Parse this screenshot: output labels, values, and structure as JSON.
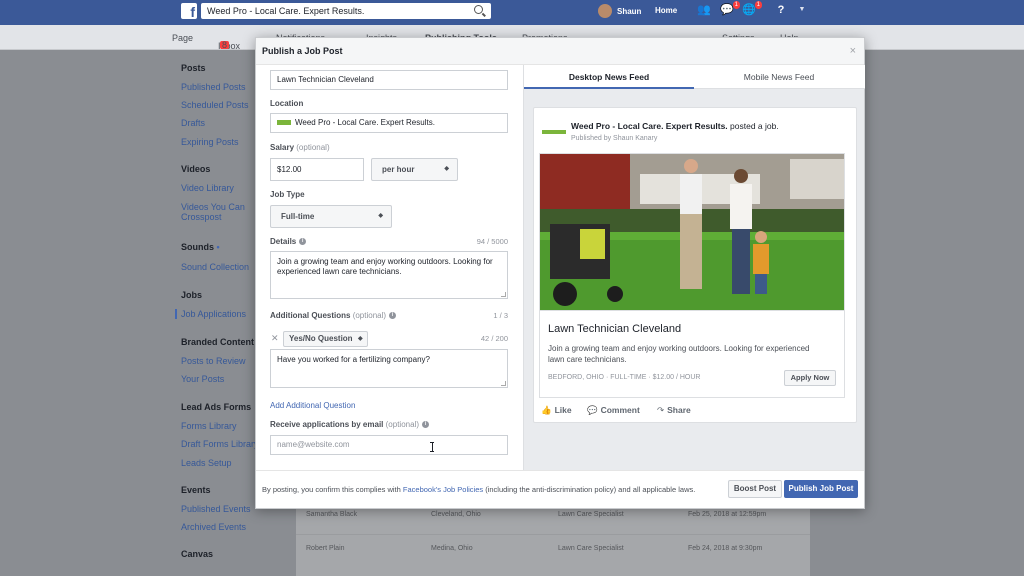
{
  "topbar": {
    "search_value": "Weed Pro - Local Care. Expert Results.",
    "user_name": "Shaun",
    "home_label": "Home",
    "badge_messages": "1",
    "badge_notifications": "1"
  },
  "pagenav": {
    "page": "Page",
    "inbox": "Inbox",
    "inbox_badge": "8",
    "notifications": "Notifications",
    "insights": "Insights",
    "publishing_tools": "Publishing Tools",
    "promotions": "Promotions",
    "settings": "Settings",
    "help": "Help"
  },
  "sidebar": {
    "posts_head": "Posts",
    "published_posts": "Published Posts",
    "scheduled_posts": "Scheduled Posts",
    "drafts": "Drafts",
    "expiring_posts": "Expiring Posts",
    "videos_head": "Videos",
    "video_library": "Video Library",
    "videos_crosspost_1": "Videos You Can",
    "videos_crosspost_2": "Crosspost",
    "sounds_head": "Sounds",
    "sounds_dot": "•",
    "sound_collection": "Sound Collection",
    "jobs_head": "Jobs",
    "job_applications": "Job Applications",
    "branded_head": "Branded Content",
    "posts_to_review": "Posts to Review",
    "your_posts": "Your Posts",
    "leadads_head": "Lead Ads Forms",
    "forms_library": "Forms Library",
    "draft_forms_library": "Draft Forms Library",
    "leads_setup": "Leads Setup",
    "events_head": "Events",
    "published_events": "Published Events",
    "archived_events": "Archived Events",
    "canvas_head": "Canvas"
  },
  "bg_table": {
    "rows": [
      {
        "name": "Samantha Black",
        "location": "Cleveland, Ohio",
        "role": "Lawn Care Specialist",
        "date": "Feb 25, 2018 at 12:59pm"
      },
      {
        "name": "Robert Plain",
        "location": "Medina, Ohio",
        "role": "Lawn Care Specialist",
        "date": "Feb 24, 2018 at 9:30pm"
      }
    ]
  },
  "modal": {
    "title": "Publish a Job Post",
    "close": "×",
    "job_title_value": "Lawn Technician Cleveland",
    "location_label": "Location",
    "location_value": "Weed Pro - Local Care. Expert Results.",
    "salary_label": "Salary",
    "salary_optional": "(optional)",
    "salary_value": "$12.00",
    "salary_period": "per hour",
    "job_type_label": "Job Type",
    "job_type_value": "Full-time",
    "details_label": "Details",
    "details_counter": "94 / 5000",
    "details_value": "Join a growing team and enjoy working outdoors. Looking for experienced lawn care technicians.",
    "additional_label": "Additional Questions",
    "additional_optional": "(optional)",
    "additional_counter": "1 / 3",
    "question_type": "Yes/No Question",
    "question_counter": "42 / 200",
    "question_value": "Have you worked for a fertilizing company?",
    "add_question_link": "Add Additional Question",
    "email_label": "Receive applications by email",
    "email_optional": "(optional)",
    "email_placeholder": "name@website.com",
    "footer_prefix": "By posting, you confirm this complies with ",
    "footer_link": "Facebook's Job Policies",
    "footer_suffix": " (including the anti-discrimination policy) and all applicable laws.",
    "boost_button": "Boost Post",
    "publish_button": "Publish Job Post"
  },
  "preview": {
    "tab_desktop": "Desktop News Feed",
    "tab_mobile": "Mobile News Feed",
    "author": "Weed Pro - Local Care. Expert Results.",
    "author_action": " posted a job.",
    "published_by": "Published by Shaun Kanary",
    "job_title": "Lawn Technician Cleveland",
    "job_desc": "Join a growing team and enjoy working outdoors. Looking for experienced lawn care technicians.",
    "job_meta": "BEDFORD, OHIO · FULL-TIME · $12.00 / HOUR",
    "apply_button": "Apply Now",
    "like": "Like",
    "comment": "Comment",
    "share": "Share"
  },
  "colors": {
    "brand": "#3b5998",
    "accent": "#4267b2",
    "logo_green": "#7bb53b"
  }
}
